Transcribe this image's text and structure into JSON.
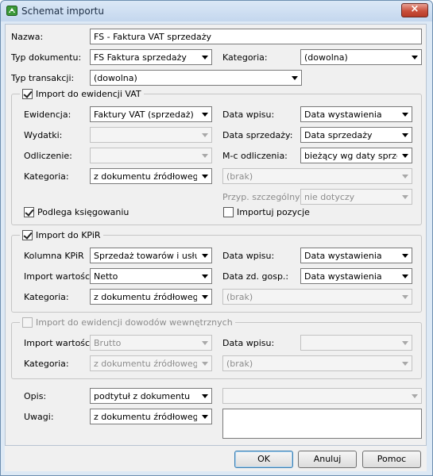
{
  "window": {
    "title": "Schemat importu"
  },
  "top": {
    "nazwa_label": "Nazwa:",
    "nazwa_value": "FS - Faktura VAT sprzedaży",
    "typ_dok_label": "Typ dokumentu:",
    "typ_dok_value": "FS Faktura sprzedaży",
    "kategoria_label": "Kategoria:",
    "kategoria_value": "(dowolna)",
    "typ_trans_label": "Typ transakcji:",
    "typ_trans_value": "(dowolna)"
  },
  "vat": {
    "title": "Import do ewidencji VAT",
    "checked": true,
    "ewidencja_label": "Ewidencja:",
    "ewidencja_value": "Faktury VAT (sprzedaż)",
    "data_wpisu_label": "Data wpisu:",
    "data_wpisu_value": "Data wystawienia",
    "wydatki_label": "Wydatki:",
    "wydatki_value": "",
    "data_sprzedazy_label": "Data sprzedaży:",
    "data_sprzedazy_value": "Data sprzedaży",
    "odliczenie_label": "Odliczenie:",
    "odliczenie_value": "",
    "mc_odliczenia_label": "M-c odliczenia:",
    "mc_odliczenia_value": "bieżący wg daty sprzedaży",
    "kategoria_label": "Kategoria:",
    "kategoria_value": "z dokumentu źródłowego",
    "kategoria2_value": "(brak)",
    "przyp_label": "Przyp. szczególny:",
    "przyp_value": "nie dotyczy",
    "ksiegowanie_label": "Podlega księgowaniu",
    "pozycje_label": "Importuj pozycje"
  },
  "kpir": {
    "title": "Import do KPiR",
    "checked": true,
    "kolumna_label": "Kolumna KPiR",
    "kolumna_value": "Sprzedaż towarów i usług",
    "data_wpisu_label": "Data wpisu:",
    "data_wpisu_value": "Data wystawienia",
    "import_wart_label": "Import wartości:",
    "import_wart_value": "Netto",
    "data_zd_label": "Data zd. gosp.:",
    "data_zd_value": "Data wystawienia",
    "kategoria_label": "Kategoria:",
    "kategoria_value": "z dokumentu źródłowego",
    "kategoria2_value": "(brak)"
  },
  "dowody": {
    "title": "Import do ewidencji dowodów wewnętrznych",
    "checked": false,
    "import_wart_label": "Import wartości:",
    "import_wart_value": "Brutto",
    "data_wpisu_label": "Data wpisu:",
    "data_wpisu_value": "",
    "kategoria_label": "Kategoria:",
    "kategoria_value": "z dokumentu źródłowego",
    "kategoria2_value": "(brak)"
  },
  "bottom": {
    "opis_label": "Opis:",
    "opis_value": "podtytuł z dokumentu",
    "opis2_value": "",
    "uwagi_label": "Uwagi:",
    "uwagi_value": "z dokumentu źródłowego",
    "uwagi_text": ""
  },
  "buttons": {
    "ok": "OK",
    "anuluj": "Anuluj",
    "pomoc": "Pomoc"
  }
}
